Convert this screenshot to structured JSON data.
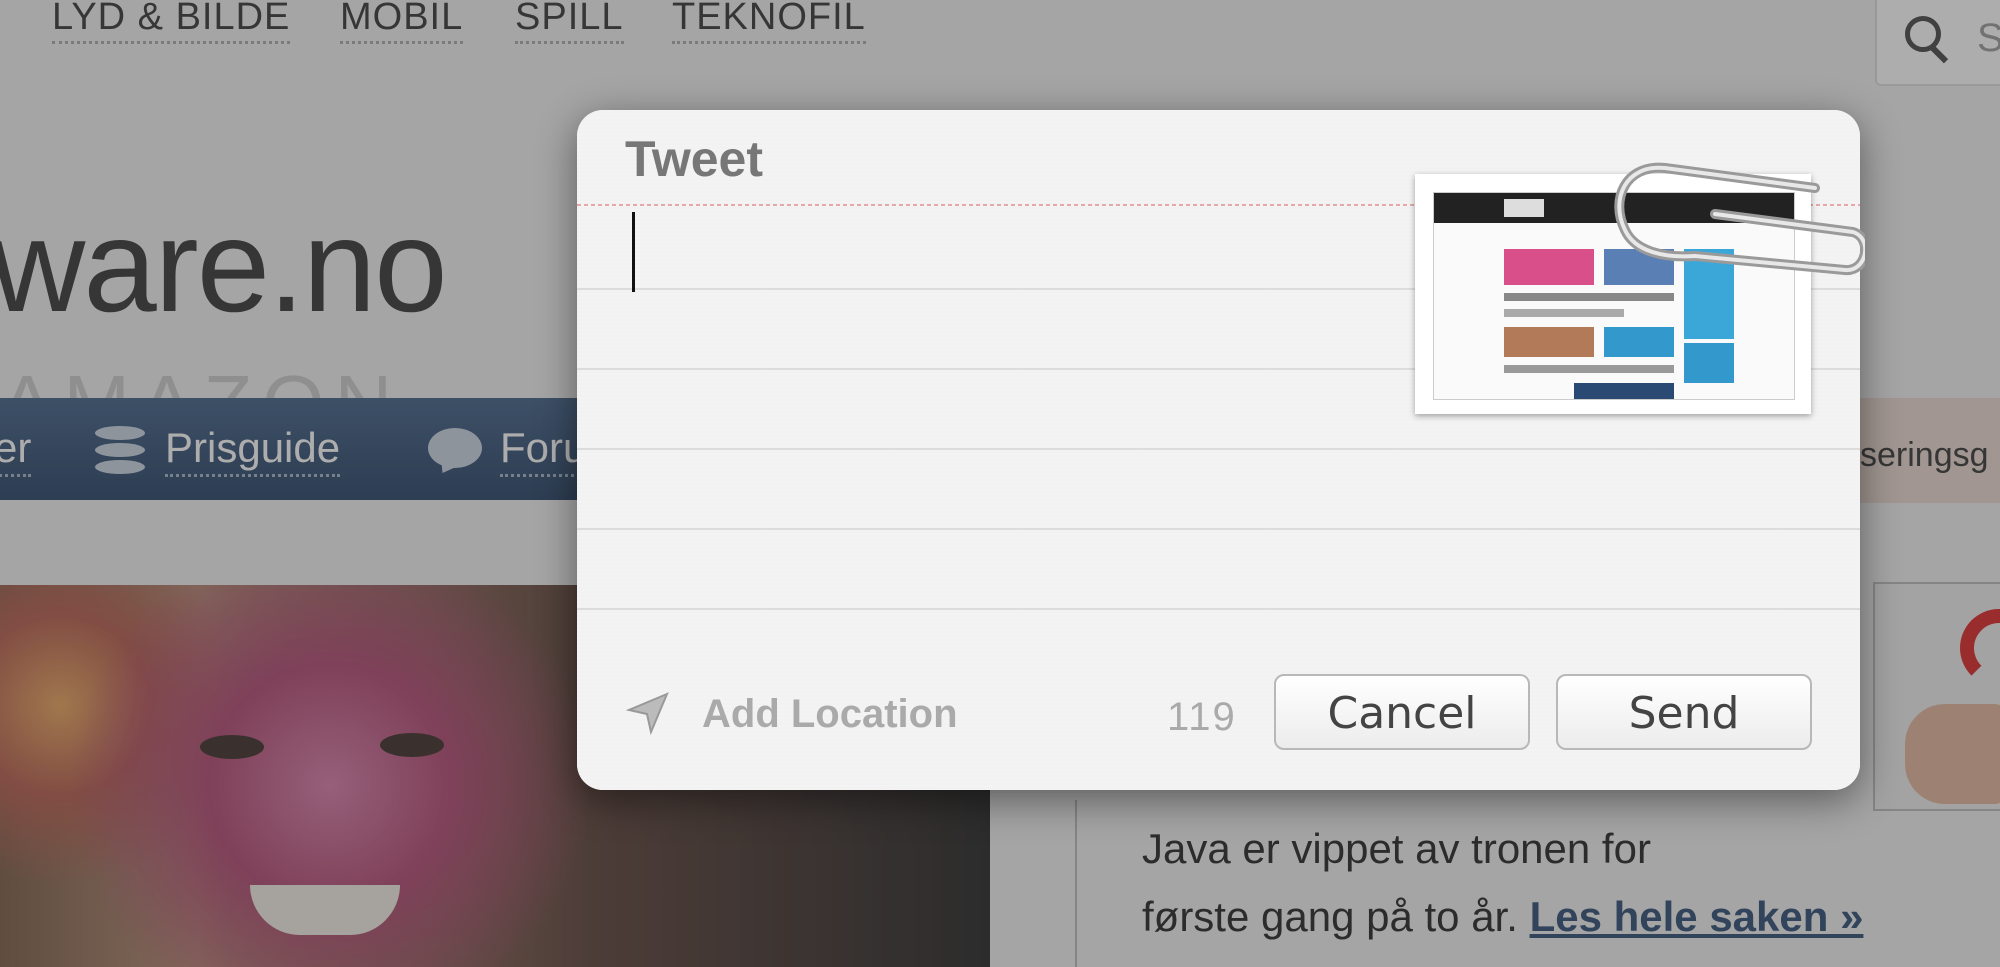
{
  "background": {
    "nav_items": [
      "LYD & BILDE",
      "MOBIL",
      "SPILL",
      "TEKNOFIL"
    ],
    "search_partial": "S",
    "brand_text": "ware.no",
    "bar_items": [
      {
        "label": "er"
      },
      {
        "label": "Prisguide"
      },
      {
        "label": "Foru"
      }
    ],
    "right_tab_partial": "seringsg",
    "article_line1": "Java er vippet av tronen for",
    "article_line2_prefix": "første gang på to år.",
    "article_link": "Les hele saken »"
  },
  "tweet_sheet": {
    "title": "Tweet",
    "text_value": "",
    "add_location_label": "Add Location",
    "char_count": "119",
    "cancel_label": "Cancel",
    "send_label": "Send",
    "attachment": "page-screenshot-thumbnail"
  },
  "colors": {
    "sheet_bg": "#f3f3f3",
    "nav_bar": "#2e4b70",
    "dim_overlay": "rgba(60,60,60,0.42)",
    "link": "#2a4a73"
  },
  "icons": [
    "search-icon",
    "database-icon",
    "speech-bubble-icon",
    "location-arrow-icon",
    "paperclip-icon"
  ]
}
